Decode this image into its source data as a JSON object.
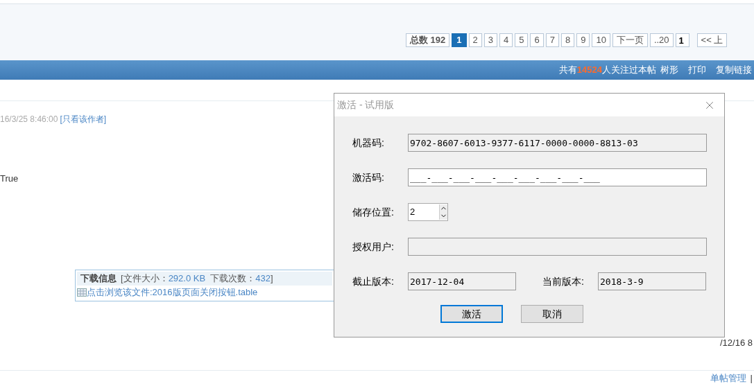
{
  "pagination": {
    "total": "总数 192",
    "pages": [
      {
        "label": "1",
        "selected": true
      },
      {
        "label": "2",
        "selected": false
      },
      {
        "label": "3",
        "selected": false
      },
      {
        "label": "4",
        "selected": false
      },
      {
        "label": "5",
        "selected": false
      },
      {
        "label": "6",
        "selected": false
      },
      {
        "label": "7",
        "selected": false
      },
      {
        "label": "8",
        "selected": false
      },
      {
        "label": "9",
        "selected": false
      },
      {
        "label": "10",
        "selected": false
      }
    ],
    "next": "下一页",
    "last": "..20",
    "page_input": "1",
    "prev": "<< 上"
  },
  "toolbar": {
    "followers_prefix": "共有",
    "followers_count": "14524",
    "followers_suffix": "人关注过本帖",
    "links": [
      "树形",
      "打印",
      "复制链接"
    ]
  },
  "post": {
    "timestamp": "16/3/25 8:46:00",
    "author_link": "[只看该作者]",
    "body": "True",
    "download": {
      "title": "下载信息",
      "size_label": "[文件大小：",
      "size": "292.0 KB",
      "count_label": "下载次数：",
      "count": "432",
      "close": "]",
      "file_link": "点击浏览该文件:2016版页面关闭按钮.table"
    }
  },
  "next_post_time": "/12/16 8",
  "footer_link": "单帖管理",
  "footer_sep": "|",
  "dialog": {
    "title": "激活 - 试用版",
    "fields": [
      {
        "label": "机器码:",
        "value": "9702-8607-6013-9377-6117-0000-0000-8813-03",
        "disabled": true
      },
      {
        "label": "激活码:",
        "value": "___-___-___-___-___-___-___-___-___",
        "disabled": false
      },
      {
        "label": "储存位置:",
        "value": "2",
        "kind": "spinner",
        "disabled": false
      },
      {
        "label": "授权用户:",
        "disabled": true
      }
    ],
    "versions": [
      {
        "label": "截止版本:",
        "value": "2017-12-04"
      },
      {
        "label": "当前版本:",
        "value": "2018-3-9"
      }
    ],
    "buttons": [
      {
        "label": "激活",
        "selected": true
      },
      {
        "label": "取消",
        "selected": false
      }
    ]
  }
}
